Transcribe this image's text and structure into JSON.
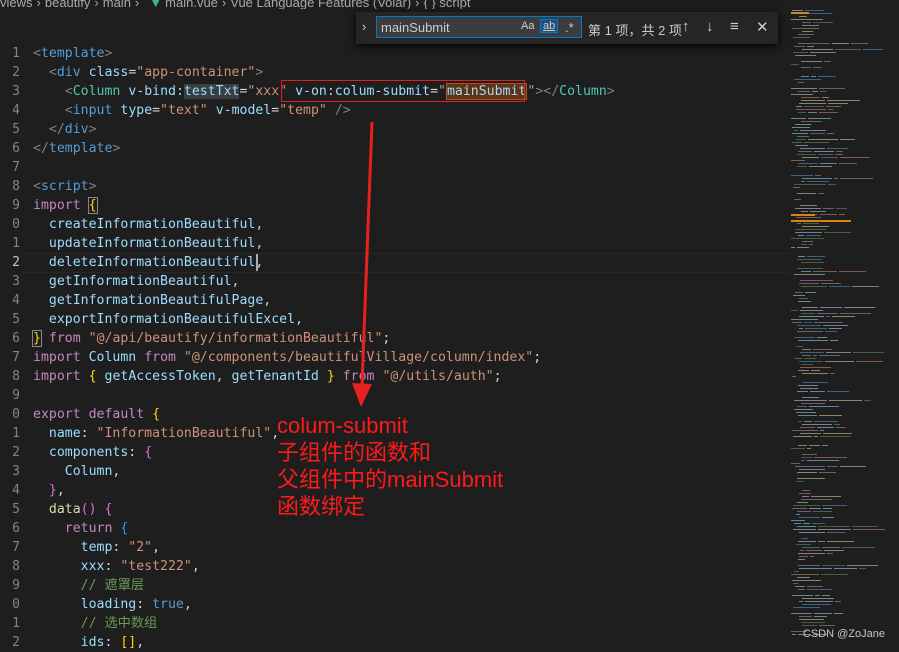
{
  "breadcrumb": {
    "items": [
      "views",
      "beautify",
      "main",
      "main.vue",
      "Vue Language Features (Volar)",
      "{ } script"
    ]
  },
  "find": {
    "query": "mainSubmit",
    "match_case": "Aa",
    "whole_word": "ab",
    "regex": ".*",
    "count": "第 1 项，共 2 项"
  },
  "line_numbers": [
    "1",
    "2",
    "3",
    "4",
    "5",
    "6",
    "7",
    "8",
    "9",
    "0",
    "1",
    "2",
    "3",
    "4",
    "5",
    "6",
    "7",
    "8",
    "9",
    "0",
    "1",
    "2",
    "3",
    "4",
    "5",
    "6",
    "7",
    "8",
    "9",
    "0",
    "1",
    "2"
  ],
  "active_line_index": 13,
  "code": {
    "l1": [
      "<template>"
    ],
    "l2_open": "<div",
    "l2_attr": "class",
    "l2_val": "\"app-container\"",
    "l3_tag": "<Column",
    "l3_attr1": "v-bind:",
    "l3_attr1b": "testTxt",
    "l3_val1": "\"xxx\"",
    "l3_attr2": "v-on:colum-submit",
    "l3_val2a": "\"",
    "l3_val2b": "mainSubmit",
    "l3_val2c": "\"",
    "l3_close": "></",
    "l3_close_tag": "Column",
    "l4_tag": "<input",
    "l4_attr1": "type",
    "l4_val1": "\"text\"",
    "l4_attr2": "v-model",
    "l4_val2": "\"temp\"",
    "l4_end": "/>",
    "l5": "</div>",
    "l6": "</template>",
    "l8": "<script>",
    "import_kw": "import",
    "items": [
      "createInformationBeautiful,",
      "updateInformationBeautiful,",
      "deleteInformationBeautiful,",
      "getInformationBeautiful,",
      "getInformationBeautifulPage,",
      "exportInformationBeautifulExcel,"
    ],
    "from_kw": "from",
    "path1": "\"@/api/beautify/informationBeautiful\"",
    "column_name": "Column",
    "path2": "\"@/components/beautifulVillage/column/index\"",
    "auth_names": "getAccessToken, getTenantId",
    "path3": "\"@/utils/auth\"",
    "export_kw": "export",
    "default_kw": "default",
    "name_key": "name",
    "name_val": "\"InformationBeautiful\"",
    "components_key": "components",
    "data_fn": "data",
    "return_kw": "return",
    "temp_key": "temp",
    "temp_val": "\"2\"",
    "xxx_key": "xxx",
    "xxx_val": "\"test222\"",
    "comment1": "// 遮罩层",
    "loading_key": "loading",
    "loading_val": "true",
    "comment2": "// 选中数组",
    "ids_key": "ids"
  },
  "annotation": {
    "lines": [
      "colum-submit",
      "子组件的函数和",
      "父组件中的mainSubmit",
      "函数绑定"
    ]
  },
  "watermark": "CSDN @ZoJane",
  "colors": {
    "annotation": "#ff1a1a",
    "vue": "#41b883"
  }
}
